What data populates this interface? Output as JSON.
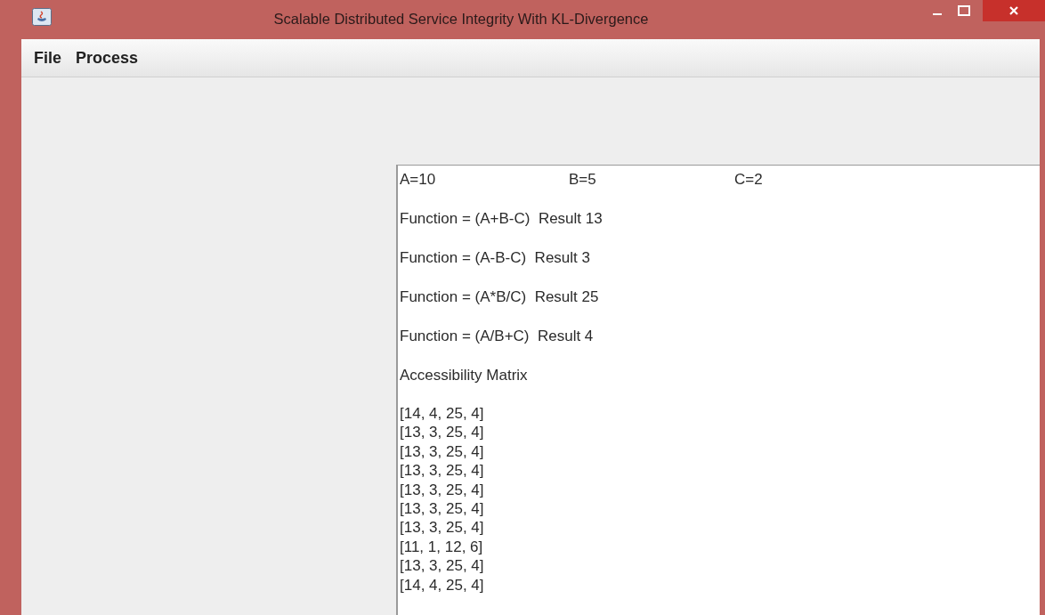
{
  "window": {
    "title": "Scalable Distributed Service Integrity With KL-Divergence"
  },
  "menu": [
    "File",
    "Process"
  ],
  "output": {
    "variables": [
      "A=10",
      "B=5",
      "C=2"
    ],
    "functions": [
      "Function = (A+B-C)  Result 13",
      "Function = (A-B-C)  Result 3",
      "Function = (A*B/C)  Result 25",
      "Function = (A/B+C)  Result 4"
    ],
    "matrix_title": "Accessibility Matrix",
    "matrix_rows": [
      "[14, 4, 25, 4]",
      "[13, 3, 25, 4]",
      "[13, 3, 25, 4]",
      "[13, 3, 25, 4]",
      "[13, 3, 25, 4]",
      "[13, 3, 25, 4]",
      "[13, 3, 25, 4]",
      "[11, 1, 12, 6]",
      "[13, 3, 25, 4]",
      "[14, 4, 25, 4]"
    ]
  }
}
